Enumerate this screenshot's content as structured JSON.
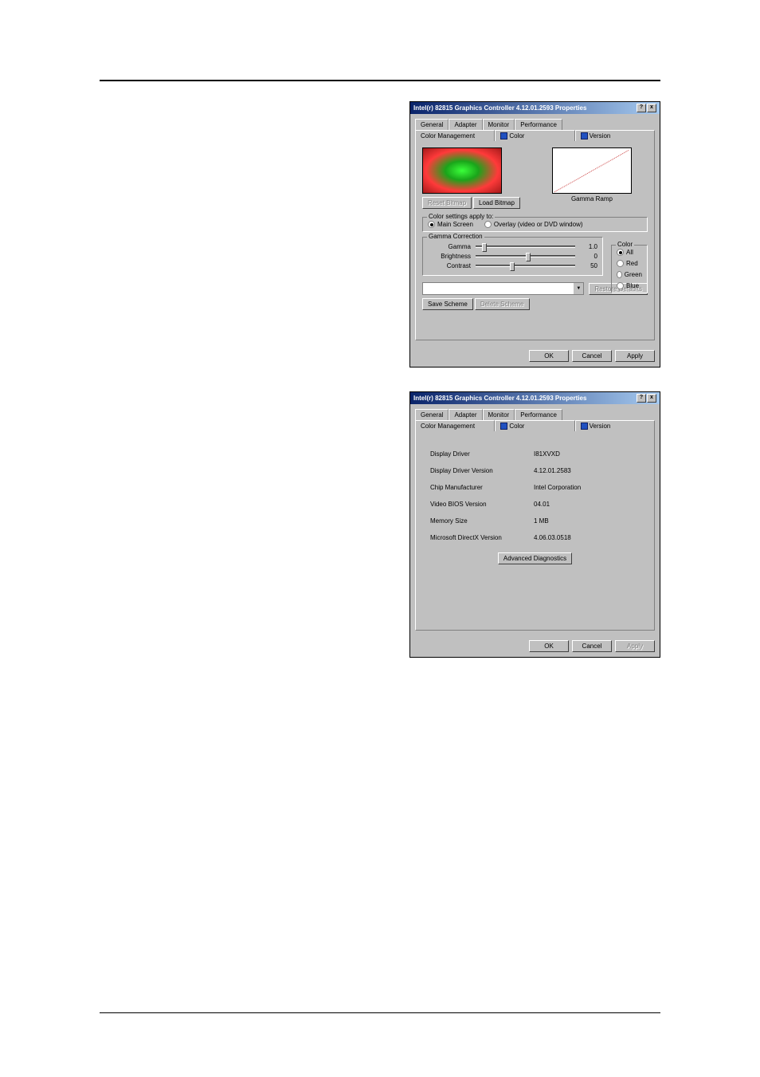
{
  "dialog1": {
    "title": "Intel(r) 82815 Graphics Controller 4.12.01.2593 Properties",
    "help": "?",
    "close": "x",
    "tabs": {
      "general": "General",
      "adapter": "Adapter",
      "monitor": "Monitor",
      "performance": "Performance",
      "colormgmt": "Color Management",
      "color": "Color",
      "version": "Version"
    },
    "resetBitmap": "Reset Bitmap",
    "loadBitmap": "Load Bitmap",
    "rampLabel": "Gamma Ramp",
    "settingsGroup": "Color settings apply to:",
    "mainScreen": "Main Screen",
    "overlay": "Overlay (video or DVD window)",
    "gammaGroup": "Gamma Correction",
    "gamma": {
      "label": "Gamma",
      "value": "1.0",
      "pos": 6
    },
    "brightness": {
      "label": "Brightness",
      "value": "0",
      "pos": 50
    },
    "contrast": {
      "label": "Contrast",
      "value": "50",
      "pos": 34
    },
    "colorGroup": "Color",
    "all": "All",
    "red": "Red",
    "green": "Green",
    "blue": "Blue",
    "restoreDefaults": "Restore Defaults",
    "saveScheme": "Save Scheme",
    "deleteScheme": "Delete Scheme",
    "ok": "OK",
    "cancel": "Cancel",
    "apply": "Apply"
  },
  "dialog2": {
    "title": "Intel(r) 82815 Graphics Controller 4.12.01.2593 Properties",
    "help": "?",
    "close": "x",
    "tabs": {
      "general": "General",
      "adapter": "Adapter",
      "monitor": "Monitor",
      "performance": "Performance",
      "colormgmt": "Color Management",
      "color": "Color",
      "version": "Version"
    },
    "rows": [
      {
        "label": "Display Driver",
        "value": "I81XVXD"
      },
      {
        "label": "Display Driver Version",
        "value": "4.12.01.2583"
      },
      {
        "label": "Chip Manufacturer",
        "value": "Intel Corporation"
      },
      {
        "label": "Video BIOS Version",
        "value": "04.01"
      },
      {
        "label": "Memory Size",
        "value": "1 MB"
      },
      {
        "label": "Microsoft DirectX Version",
        "value": "4.06.03.0518"
      }
    ],
    "advanced": "Advanced Diagnostics",
    "ok": "OK",
    "cancel": "Cancel",
    "apply": "Apply"
  }
}
